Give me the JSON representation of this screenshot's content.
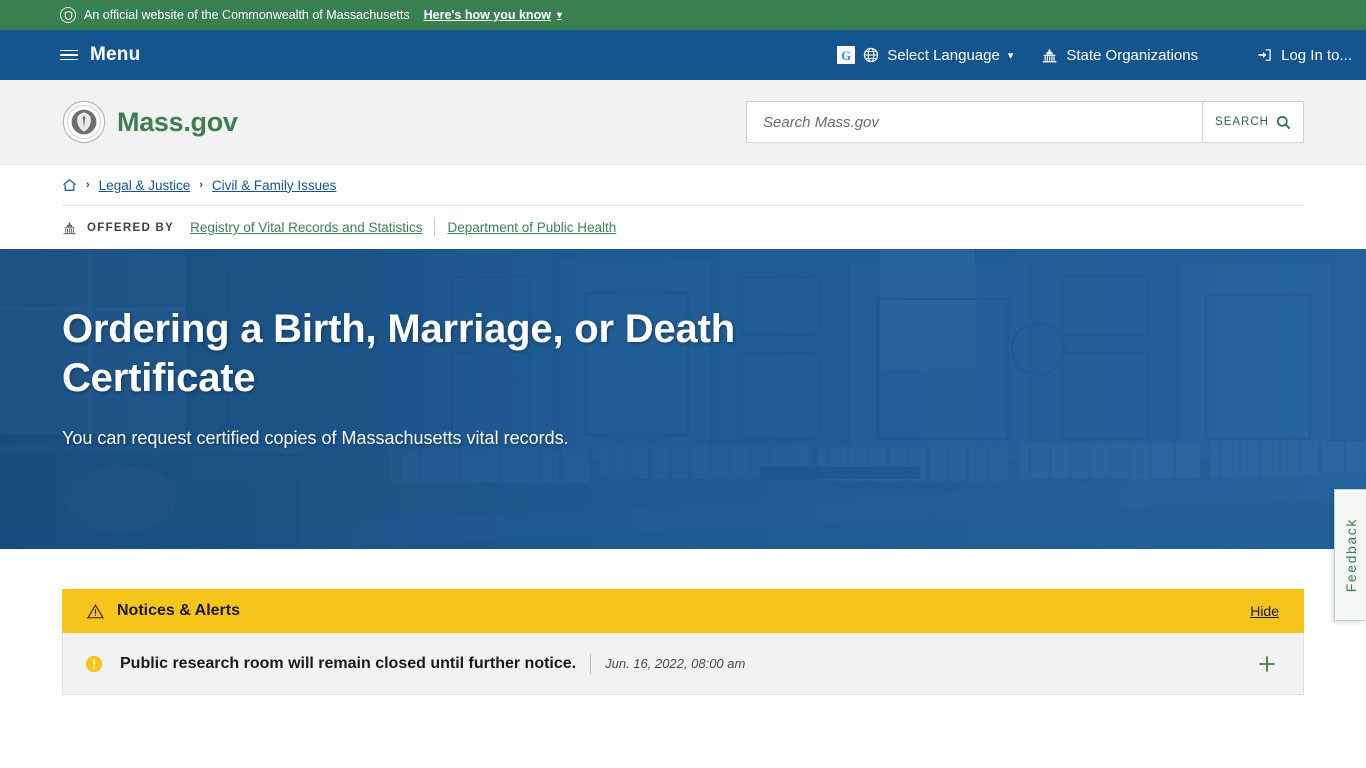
{
  "official_banner": {
    "seal_icon": "state-seal-icon",
    "text": "An official website of the Commonwealth of Massachusetts",
    "how_you_know_label": "Here's how you know",
    "chevron_icon": "chevron-down-icon",
    "background_color": "#388050"
  },
  "nav": {
    "background_color": "#14558f",
    "menu_icon": "hamburger-icon",
    "menu_label": "Menu",
    "items": [
      {
        "label": "Select Language",
        "icon": "globe-icon",
        "badge_icon": "google-translate-icon",
        "caret_icon": "chevron-down-icon"
      },
      {
        "label": "State Organizations",
        "icon": "capitol-icon"
      },
      {
        "label": "Log In to...",
        "icon": "login-arrow-icon"
      }
    ]
  },
  "header": {
    "logo_icon": "massachusetts-state-seal-icon",
    "brand_name": "Mass.gov",
    "brand_color": "#3e7f52"
  },
  "search": {
    "placeholder": "Search Mass.gov",
    "value": "",
    "button_label": "SEARCH",
    "button_icon": "search-icon"
  },
  "breadcrumb": {
    "home_icon": "home-icon",
    "separator": "›",
    "items": [
      {
        "label": "Legal & Justice"
      },
      {
        "label": "Civil & Family Issues"
      }
    ]
  },
  "offered_by": {
    "icon": "capitol-icon",
    "label": "OFFERED BY",
    "organizations": [
      {
        "label": "Registry of Vital Records and Statistics"
      },
      {
        "label": "Department of Public Health"
      }
    ]
  },
  "hero": {
    "title": "Ordering a Birth, Marriage, or Death Certificate",
    "subtitle": "You can request certified copies of Massachusetts vital records.",
    "background_color": "#1f5c96"
  },
  "alerts": {
    "header": {
      "icon": "warning-triangle-icon",
      "title": "Notices & Alerts",
      "hide_label": "Hide",
      "background_color": "#f6c51b"
    },
    "items": [
      {
        "icon": "exclamation-circle-icon",
        "message": "Public research room will remain closed until further notice.",
        "timestamp": "Jun. 16, 2022, 08:00 am",
        "expand_icon": "plus-icon"
      }
    ]
  },
  "feedback_tab": {
    "label": "Feedback",
    "color": "#3d7f55"
  }
}
